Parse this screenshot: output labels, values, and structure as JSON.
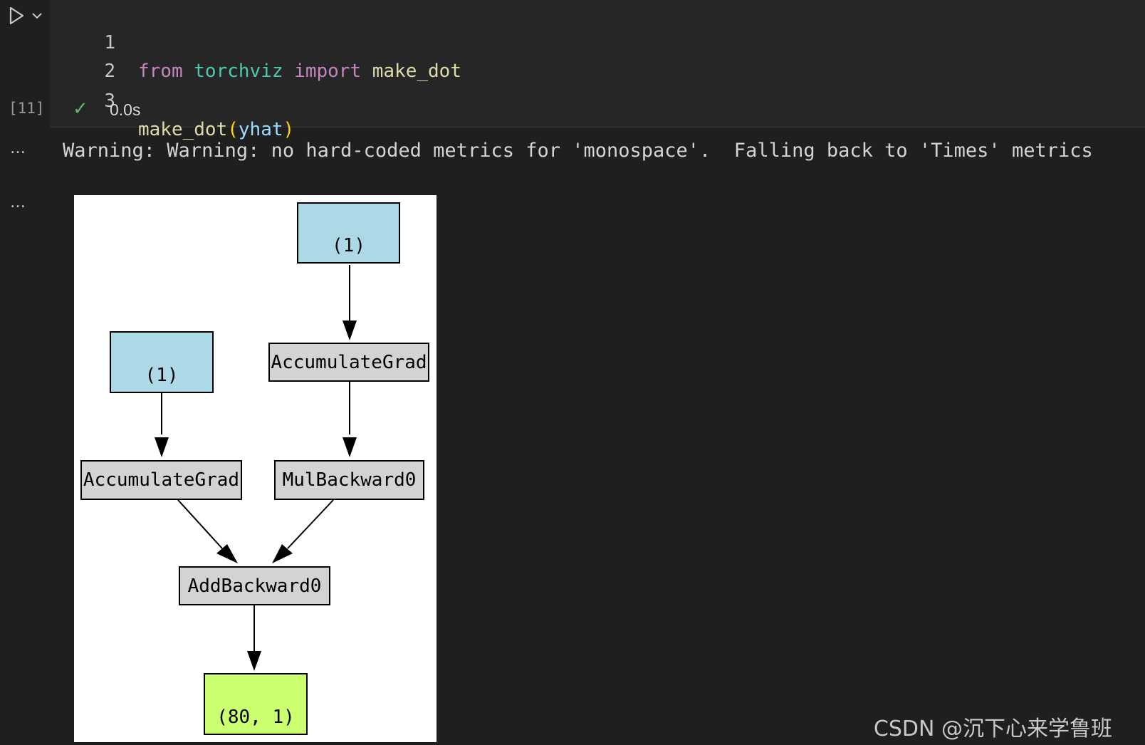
{
  "cell": {
    "lines": [
      {
        "number": "1",
        "tokens": [
          {
            "text": "from",
            "kind": "kw"
          },
          {
            "text": " ",
            "kind": "plain"
          },
          {
            "text": "torchviz",
            "kind": "mod"
          },
          {
            "text": " ",
            "kind": "plain"
          },
          {
            "text": "import",
            "kind": "kw"
          },
          {
            "text": " ",
            "kind": "plain"
          },
          {
            "text": "make_dot",
            "kind": "fn"
          }
        ]
      },
      {
        "number": "2",
        "tokens": []
      },
      {
        "number": "3",
        "tokens": [
          {
            "text": "make_dot",
            "kind": "fn"
          },
          {
            "text": "(",
            "kind": "paren"
          },
          {
            "text": "yhat",
            "kind": "var"
          },
          {
            "text": ")",
            "kind": "paren"
          }
        ]
      }
    ],
    "execution_count": "[11]",
    "status_icon": "check-icon",
    "status_glyph": "✓",
    "duration": "0.0s",
    "colors": {
      "success": "#5fb760",
      "keyword": "#c586c0",
      "module": "#4ec9b0",
      "function": "#dcdcaa",
      "bracket": "#ffd700",
      "variable": "#9cdcfe"
    }
  },
  "outputs": {
    "ellipsis": "…",
    "warning_text": "Warning: Warning: no hard-coded metrics for 'monospace'.  Falling back to 'Times' metrics"
  },
  "graph": {
    "nodes": {
      "tensor_top": "(1)",
      "tensor_left": "(1)",
      "accum_right": "AccumulateGrad",
      "accum_left": "AccumulateGrad",
      "mul": "MulBackward0",
      "add": "AddBackward0",
      "output": "(80, 1)"
    },
    "colors": {
      "leaf": "#add8e6",
      "grad_fn": "#d3d3d3",
      "output": "#caff70"
    }
  },
  "watermark": "CSDN @沉下心来学鲁班"
}
